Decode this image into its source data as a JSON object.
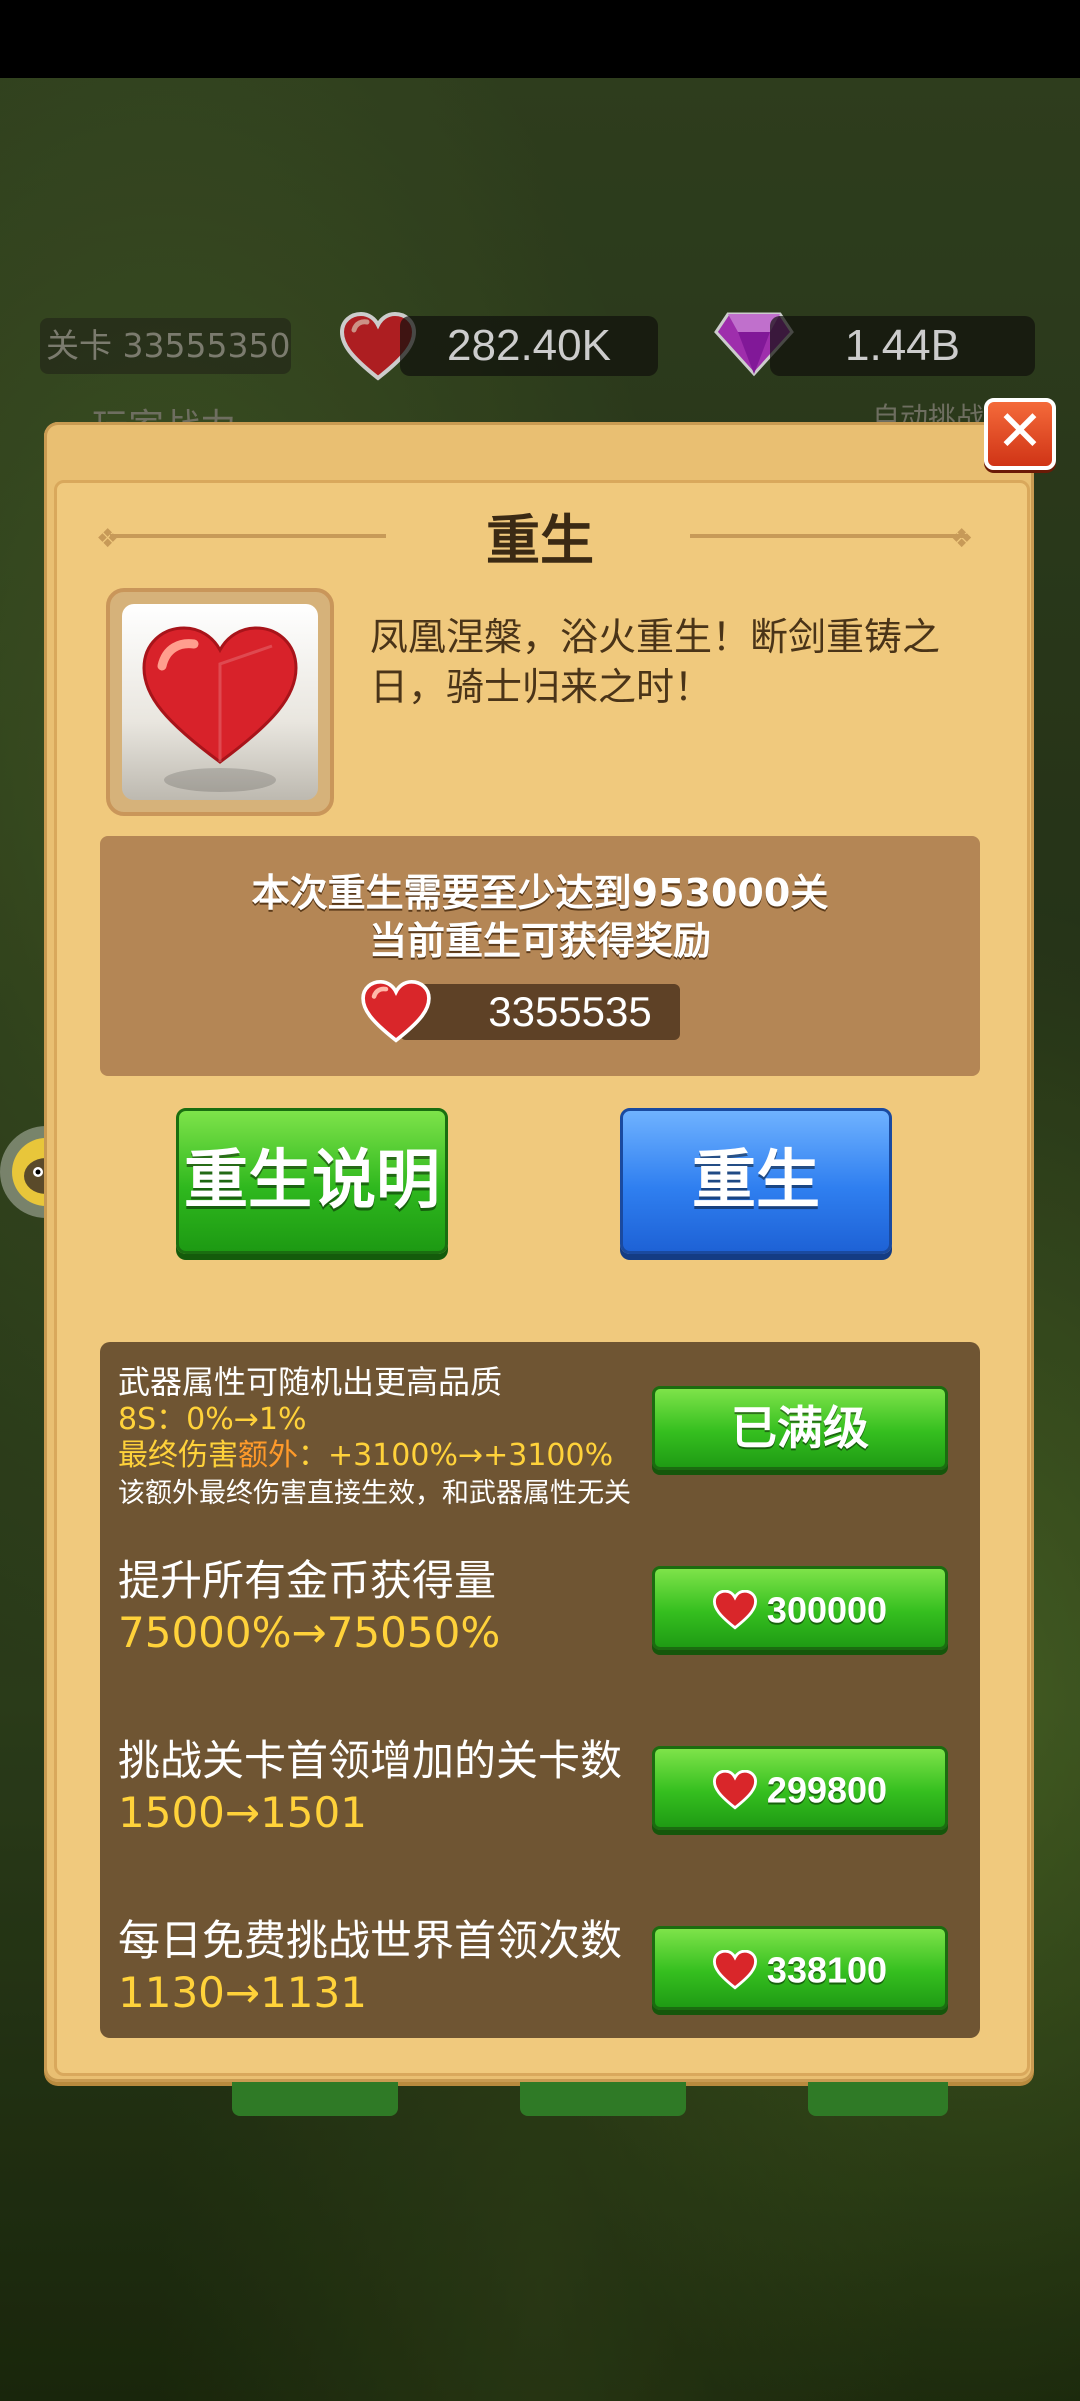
{
  "hud": {
    "level_label": "关卡 33555350",
    "hearts": "282.40K",
    "gems": "1.44B",
    "behind_left": "玩家战力",
    "behind_right": "自动挑战"
  },
  "dialog": {
    "title": "重生",
    "close_icon": "close-icon",
    "item_icon": "heart-icon",
    "description": "凤凰涅槃，浴火重生！断剑重铸之日，骑士归来之时！",
    "requirement": "本次重生需要至少达到953000关",
    "reward_label": "当前重生可获得奖励",
    "reward_value": "3355535",
    "explain_button": "重生说明",
    "rebirth_button": "重生"
  },
  "upgrades": [
    {
      "line1": "武器属性可随机出更高品质",
      "line2": "8S：0%→1%",
      "line3_a": "最终伤害",
      "line3_b": "额外",
      "line3_c": "：+3100%→+3100%",
      "line4": "该额外最终伤害直接生效，和武器属性无关",
      "button": "已满级"
    },
    {
      "title": "提升所有金币获得量",
      "value": "75000%→75050%",
      "cost": "300000"
    },
    {
      "title": "挑战关卡首领增加的关卡数",
      "value": "1500→1501",
      "cost": "299800"
    },
    {
      "title": "每日免费挑战世界首领次数",
      "value": "1130→1131",
      "cost": "338100"
    }
  ],
  "colors": {
    "panel": "#e9bf72",
    "green_button": "#2fb81e",
    "blue_button": "#2f7ff0",
    "close_button": "#e04a22",
    "value_yellow": "#ffd23a"
  }
}
